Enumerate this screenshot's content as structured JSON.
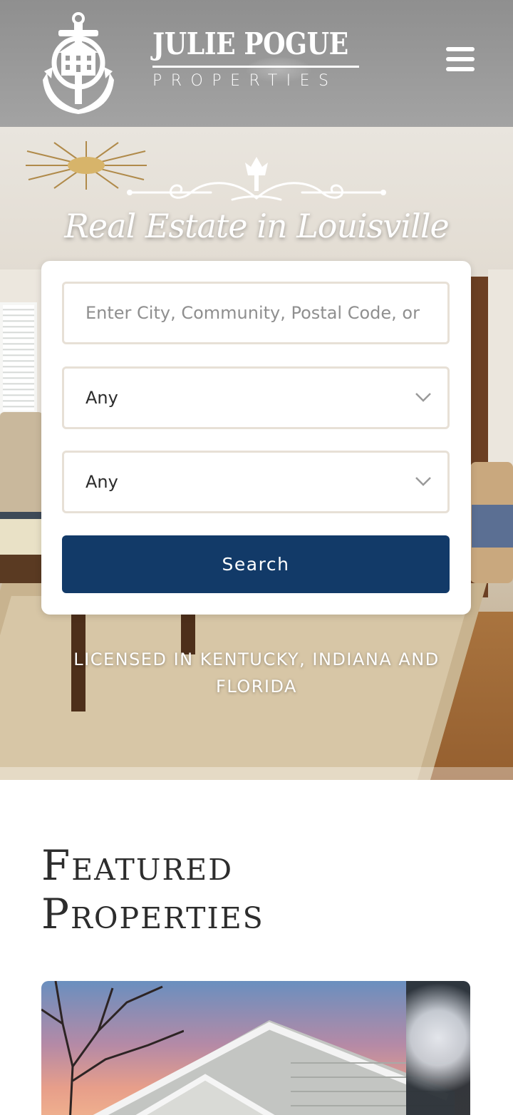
{
  "header": {
    "brand_name": "JULIE POGUE",
    "brand_sub": "PROPERTIES",
    "menu_icon": "hamburger-menu-icon"
  },
  "hero": {
    "tagline": "Real Estate in Louisville",
    "license": "LICENSED IN KENTUCKY, INDIANA AND FLORIDA"
  },
  "search": {
    "location_placeholder": "Enter City, Community, Postal Code, or",
    "select_one_value": "Any",
    "select_two_value": "Any",
    "button_label": "Search",
    "button_color": "#123a68"
  },
  "featured": {
    "title_line1": "Featured",
    "title_line2": "Properties"
  }
}
